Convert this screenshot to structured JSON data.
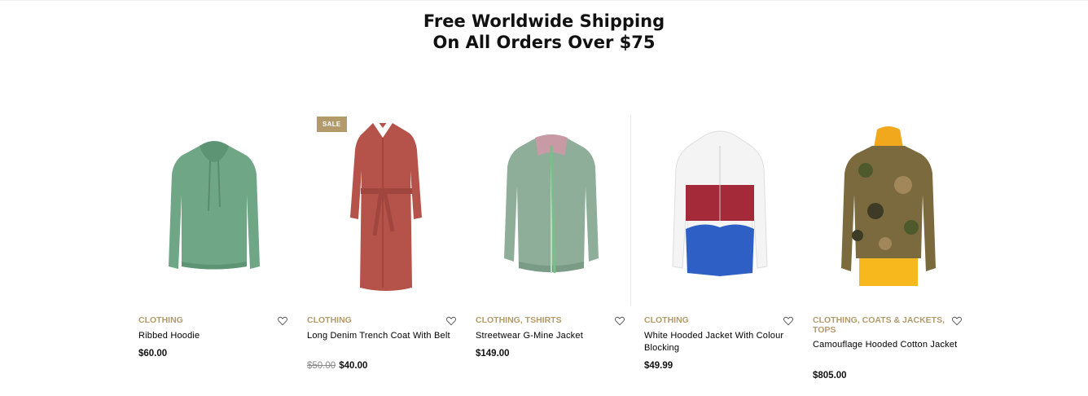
{
  "headline": {
    "line1": "Free Worldwide Shipping",
    "line2": "On All Orders Over $75"
  },
  "colors": {
    "accent": "#b39a6a",
    "text": "#111111"
  },
  "products": [
    {
      "categories": [
        "CLOTHING"
      ],
      "title": "Ribbed Hoodie",
      "price": "$60.00",
      "image_icon": "green-hoodie-image"
    },
    {
      "badge": "SALE",
      "categories": [
        "CLOTHING"
      ],
      "title": "Long Denim Trench Coat With Belt",
      "old_price": "$50.00",
      "price": "$40.00",
      "image_icon": "red-trench-coat-image"
    },
    {
      "categories": [
        "CLOTHING",
        "TSHIRTS"
      ],
      "title": "Streetwear G-Mine Jacket",
      "price": "$149.00",
      "image_icon": "green-bomber-jacket-image"
    },
    {
      "categories": [
        "CLOTHING"
      ],
      "title": "White Hooded Jacket With Colour Blocking",
      "price": "$49.99",
      "image_icon": "colorblock-jacket-image"
    },
    {
      "categories": [
        "CLOTHING",
        "COATS & JACKETS",
        "TOPS"
      ],
      "title": "Camouflage Hooded Cotton Jacket",
      "price": "$805.00",
      "image_icon": "camouflage-jacket-image"
    }
  ],
  "wishlist_icon": "heart-icon"
}
